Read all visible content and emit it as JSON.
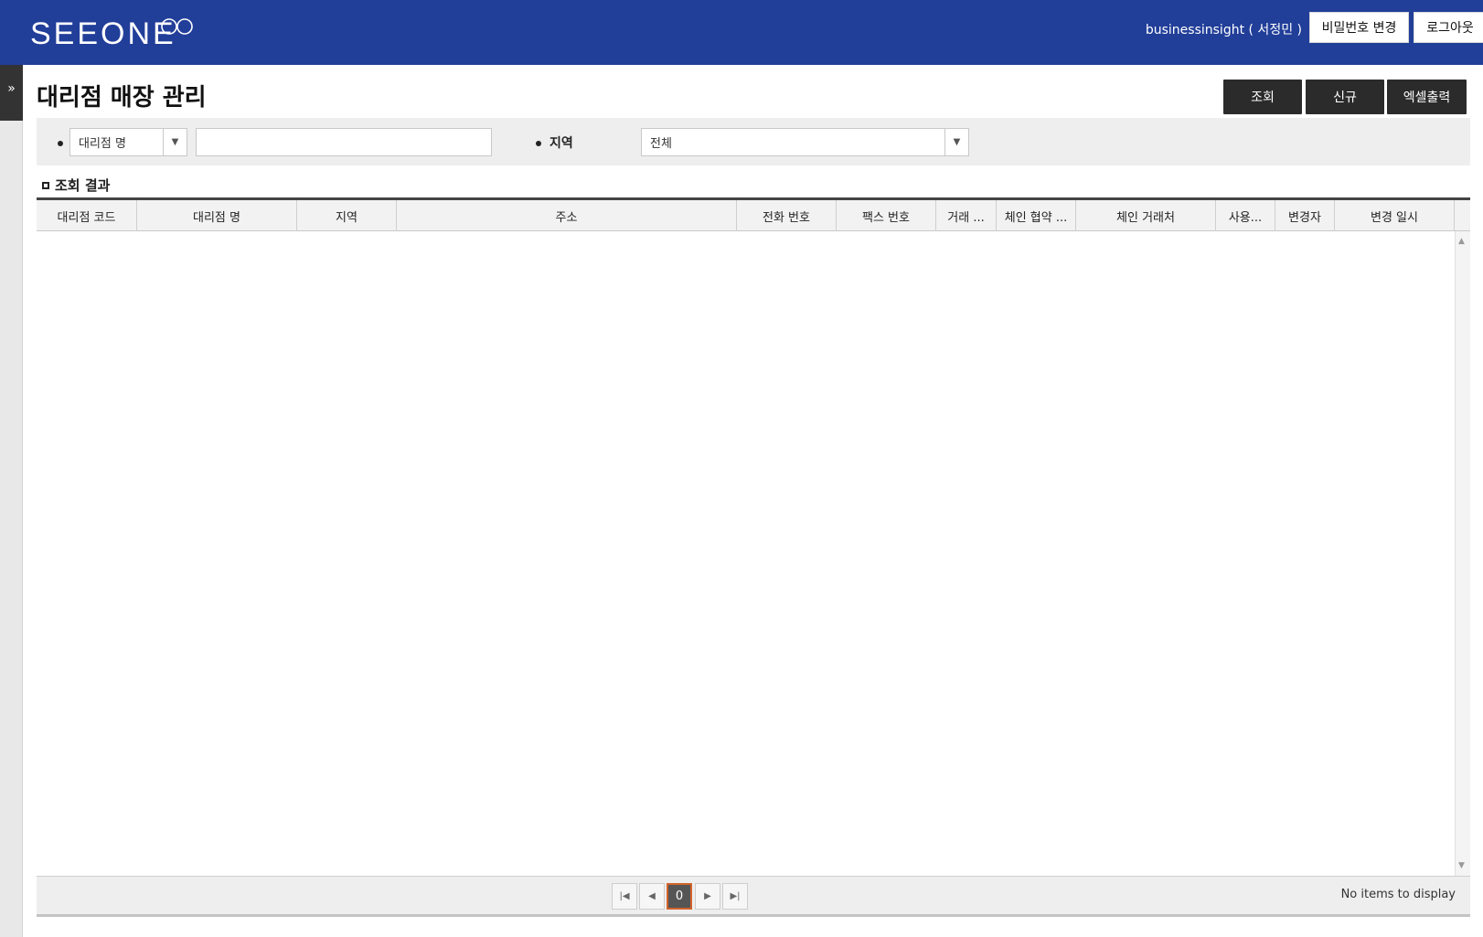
{
  "header": {
    "logo_text": "SEEONE",
    "user_label": "businessinsight ( 서정민 )",
    "change_password_label": "비밀번호 변경",
    "logout_label": "로그아웃"
  },
  "page": {
    "title": "대리점 매장 관리"
  },
  "actions": {
    "search_label": "조회",
    "new_label": "신규",
    "excel_label": "엑셀출력"
  },
  "search": {
    "field_select_value": "대리점 명",
    "keyword_value": "",
    "region_label": "지역",
    "region_select_value": "전체"
  },
  "results": {
    "title": "조회 결과",
    "columns": [
      "대리점 코드",
      "대리점 명",
      "지역",
      "주소",
      "전화 번호",
      "팩스 번호",
      "거래 ...",
      "체인 협약 ...",
      "체인 거래처",
      "사용...",
      "변경자",
      "변경 일시"
    ],
    "rows": []
  },
  "pager": {
    "current_page": "0",
    "info_text": "No items to display"
  },
  "icons": {
    "sidebar_toggle": "double-chevron-right-icon",
    "dropdown": "triangle-down-icon",
    "first": "first-page-icon",
    "prev": "prev-page-icon",
    "next": "next-page-icon",
    "last": "last-page-icon"
  },
  "colors": {
    "header_bg": "#213e99",
    "action_button_bg": "#2b2b2b",
    "pager_current_border": "#d2632b"
  }
}
